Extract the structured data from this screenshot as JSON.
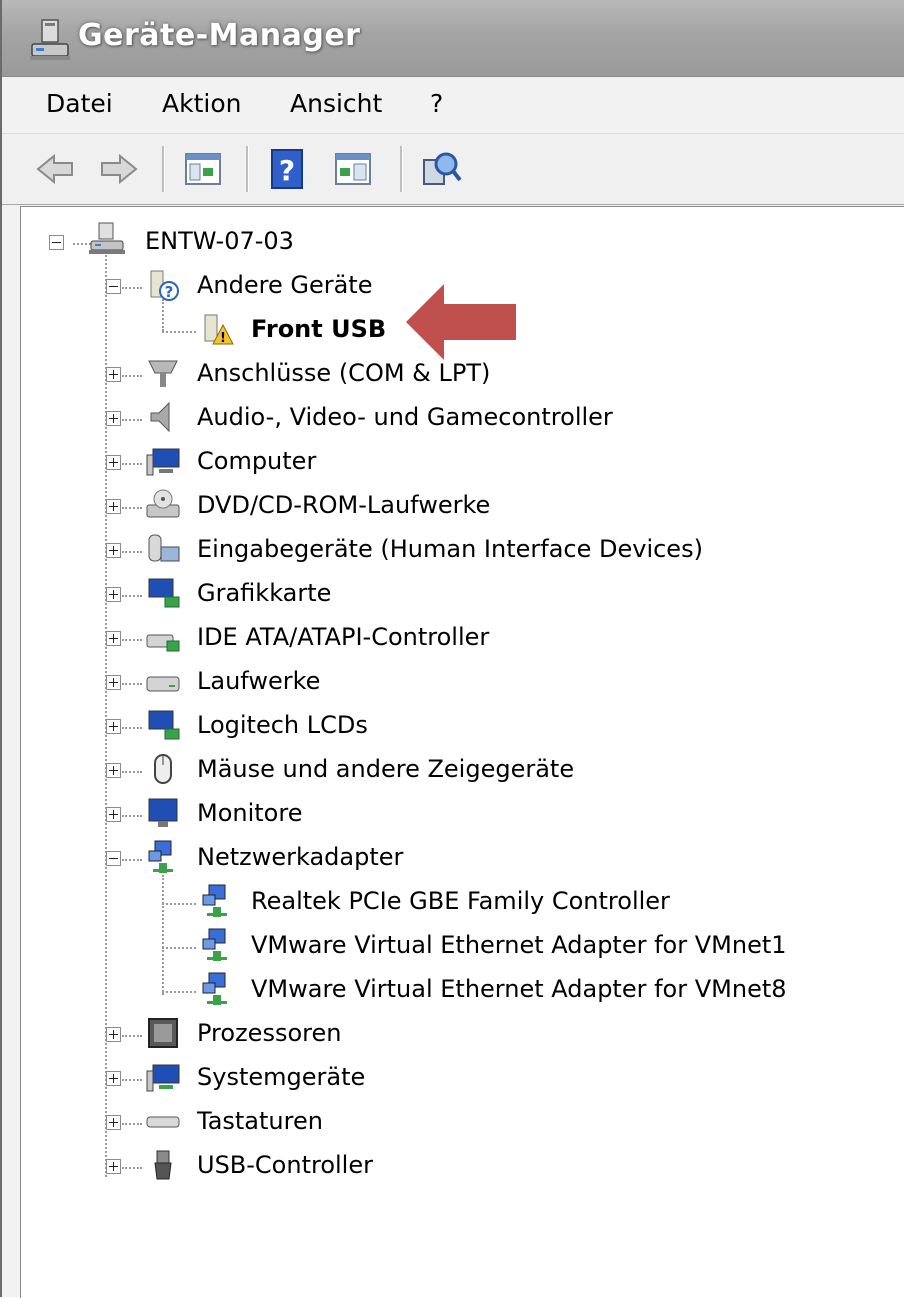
{
  "window": {
    "title": "Geräte-Manager"
  },
  "menu": [
    "Datei",
    "Aktion",
    "Ansicht",
    "?"
  ],
  "toolbar": {
    "buttons": [
      "back-arrow-icon",
      "forward-arrow-icon",
      "show-hide-console-tree-icon",
      "help-icon",
      "properties-pane-icon",
      "scan-hardware-icon"
    ]
  },
  "tree": {
    "root": "ENTW-07-03",
    "categories": [
      {
        "label": "Andere Geräte",
        "expanded": true,
        "icon": "unknown-device-icon",
        "children": [
          {
            "label": "Front USB",
            "icon": "warning-device-icon",
            "highlighted": true
          }
        ]
      },
      {
        "label": "Anschlüsse (COM & LPT)",
        "icon": "port-icon"
      },
      {
        "label": "Audio-, Video- und Gamecontroller",
        "icon": "speaker-icon"
      },
      {
        "label": "Computer",
        "icon": "computer-icon"
      },
      {
        "label": "DVD/CD-ROM-Laufwerke",
        "icon": "dvd-drive-icon"
      },
      {
        "label": "Eingabegeräte (Human Interface Devices)",
        "icon": "hid-icon"
      },
      {
        "label": "Grafikkarte",
        "icon": "display-adapter-icon"
      },
      {
        "label": "IDE ATA/ATAPI-Controller",
        "icon": "ide-controller-icon"
      },
      {
        "label": "Laufwerke",
        "icon": "disk-drive-icon"
      },
      {
        "label": "Logitech LCDs",
        "icon": "lcd-icon"
      },
      {
        "label": "Mäuse und andere Zeigegeräte",
        "icon": "mouse-icon"
      },
      {
        "label": "Monitore",
        "icon": "monitor-icon"
      },
      {
        "label": "Netzwerkadapter",
        "expanded": true,
        "icon": "network-adapter-icon",
        "children": [
          {
            "label": "Realtek PCIe GBE Family Controller",
            "icon": "network-adapter-icon"
          },
          {
            "label": "VMware Virtual Ethernet Adapter for VMnet1",
            "icon": "network-adapter-icon"
          },
          {
            "label": "VMware Virtual Ethernet Adapter for VMnet8",
            "icon": "network-adapter-icon"
          }
        ]
      },
      {
        "label": "Prozessoren",
        "icon": "processor-icon"
      },
      {
        "label": "Systemgeräte",
        "icon": "system-devices-icon"
      },
      {
        "label": "Tastaturen",
        "icon": "keyboard-icon"
      },
      {
        "label": "USB-Controller",
        "icon": "usb-icon"
      }
    ]
  },
  "annotation": {
    "color": "#c0504d"
  }
}
